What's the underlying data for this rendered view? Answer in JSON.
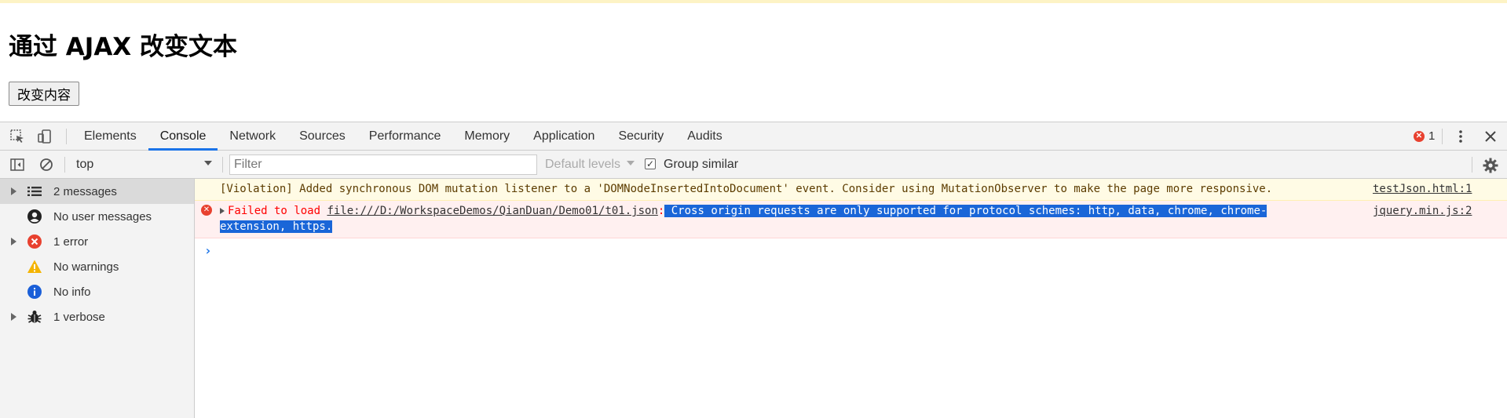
{
  "page": {
    "title": "通过 AJAX 改变文本",
    "button_label": "改变内容"
  },
  "devtools": {
    "tabs": [
      "Elements",
      "Console",
      "Network",
      "Sources",
      "Performance",
      "Memory",
      "Application",
      "Security",
      "Audits"
    ],
    "active_tab": "Console",
    "error_count": "1",
    "context": "top",
    "filter_placeholder": "Filter",
    "levels_label": "Default levels",
    "group_similar_label": "Group similar",
    "group_similar_checked": true
  },
  "sidebar": {
    "items": [
      {
        "label": "2 messages",
        "icon": "list-icon",
        "expandable": true,
        "selected": true
      },
      {
        "label": "No user messages",
        "icon": "user-icon",
        "expandable": false,
        "selected": false
      },
      {
        "label": "1 error",
        "icon": "error-icon",
        "expandable": true,
        "selected": false
      },
      {
        "label": "No warnings",
        "icon": "warning-icon",
        "expandable": false,
        "selected": false
      },
      {
        "label": "No info",
        "icon": "info-icon",
        "expandable": false,
        "selected": false
      },
      {
        "label": "1 verbose",
        "icon": "bug-icon",
        "expandable": true,
        "selected": false
      }
    ]
  },
  "console": {
    "warning": {
      "text": "[Violation] Added synchronous DOM mutation listener to a 'DOMNodeInsertedIntoDocument' event. Consider using MutationObserver to make the page more responsive.",
      "source": "testJson.html:1"
    },
    "error": {
      "prefix": "Failed to load ",
      "url": "file:///D:/WorkspaceDemos/QianDuan/Demo01/t01.json",
      "colon": ":",
      "highlight_line1": " Cross origin requests are only supported for protocol schemes: http, data, chrome, chrome-",
      "highlight_line2": "extension, https.",
      "source": "jquery.min.js:2"
    }
  },
  "colors": {
    "accent": "#1a73e8",
    "error": "#e8412f",
    "warning_bg": "#fffbe5",
    "error_bg": "#fff0f0",
    "selection": "#1a66d8"
  }
}
